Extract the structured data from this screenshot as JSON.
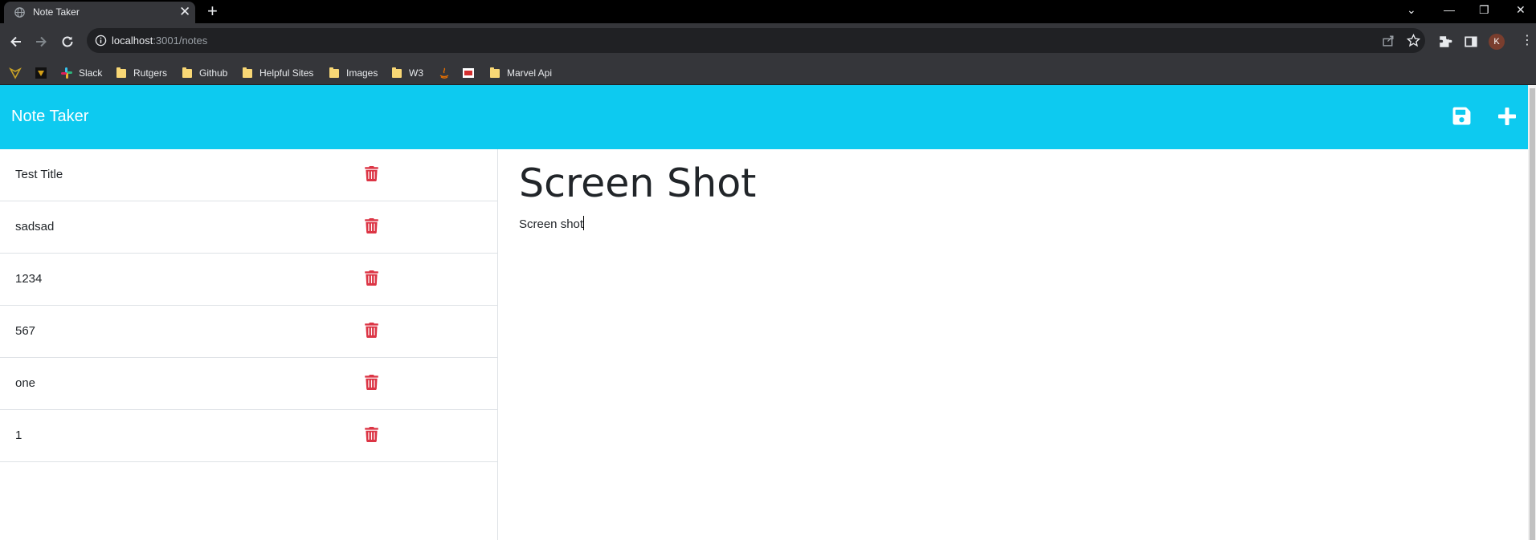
{
  "browser": {
    "tab_title": "Note Taker",
    "tab_close": "✕",
    "new_tab": "+",
    "window_controls": {
      "minimize": "—",
      "restore": "❐",
      "close": "✕",
      "tab_search": "⌄"
    },
    "url_host": "localhost",
    "url_path": ":3001/notes",
    "avatar_initial": "K",
    "menu": "⋮",
    "bookmarks": [
      {
        "label": "",
        "icon": "ext-icon-a"
      },
      {
        "label": "",
        "icon": "ext-icon-b"
      },
      {
        "label": "Slack",
        "icon": "slack-icon"
      },
      {
        "label": "Rutgers",
        "icon": "folder-icon"
      },
      {
        "label": "Github",
        "icon": "folder-icon"
      },
      {
        "label": "Helpful Sites",
        "icon": "folder-icon"
      },
      {
        "label": "Images",
        "icon": "folder-icon"
      },
      {
        "label": "W3",
        "icon": "folder-icon"
      },
      {
        "label": "",
        "icon": "java-icon"
      },
      {
        "label": "",
        "icon": "ext-icon-c"
      },
      {
        "label": "Marvel Api",
        "icon": "folder-icon"
      }
    ]
  },
  "app": {
    "brand": "Note Taker",
    "accent_color": "#0dcaf0",
    "delete_color": "#dc3545",
    "notes": [
      {
        "title": "Test Title"
      },
      {
        "title": "sadsad"
      },
      {
        "title": "1234"
      },
      {
        "title": "567"
      },
      {
        "title": "one"
      },
      {
        "title": "1"
      }
    ],
    "active_note": {
      "title": "Screen Shot",
      "text": "Screen shot"
    }
  }
}
